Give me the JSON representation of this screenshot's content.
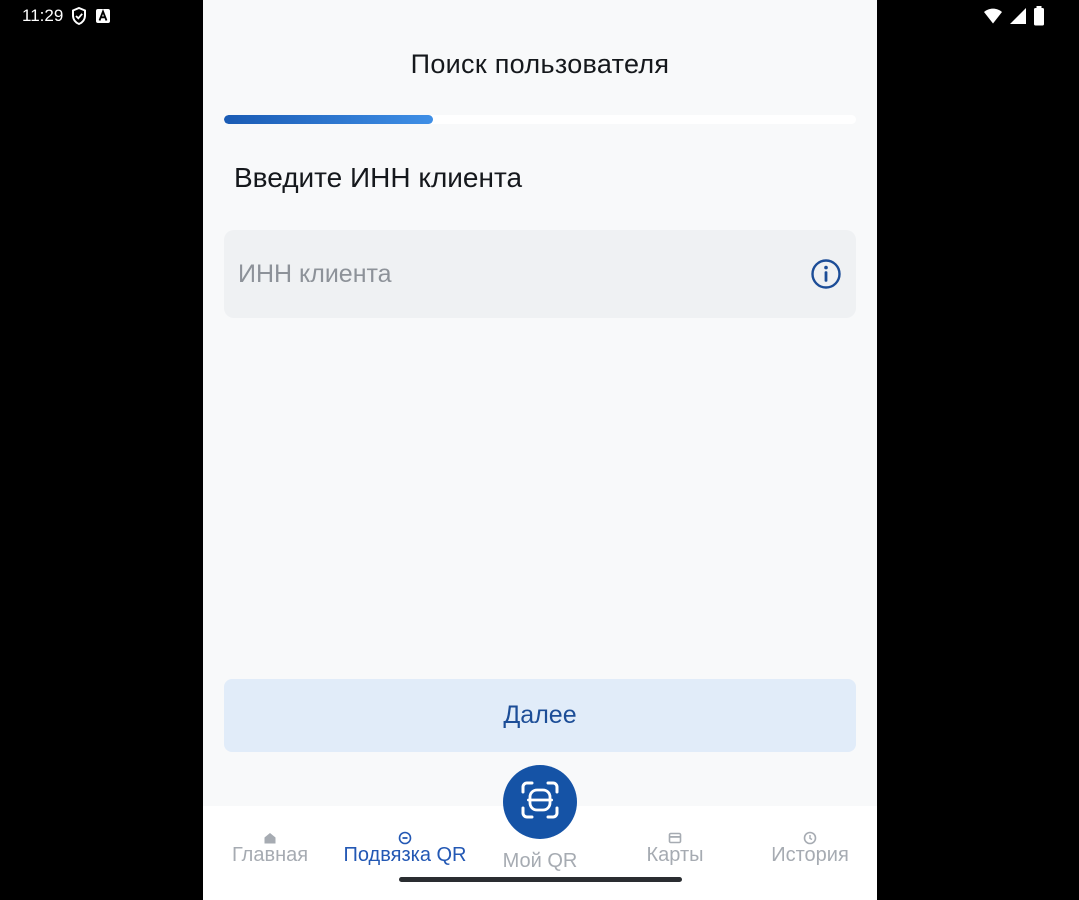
{
  "status_bar": {
    "time": "11:29",
    "icons_left": [
      "shield-icon",
      "a-badge-icon"
    ],
    "icons_right": [
      "wifi-icon",
      "cellular-signal-icon",
      "battery-icon"
    ]
  },
  "screen": {
    "title": "Поиск пользователя",
    "progress": 0.33
  },
  "form": {
    "prompt": "Введите ИНН клиента",
    "inn_field": {
      "value": "",
      "placeholder": "ИНН клиента",
      "icon": "info-icon"
    },
    "next_button_label": "Далее"
  },
  "bottom_nav": {
    "items": [
      {
        "label": "Главная",
        "icon": "home-icon",
        "active": false
      },
      {
        "label": "Подвязка QR",
        "icon": "link-qr-icon",
        "active": true
      },
      {
        "label": "Мой QR",
        "icon": "scan-qr-icon",
        "active": false
      },
      {
        "label": "Карты",
        "icon": "card-icon",
        "active": false
      },
      {
        "label": "История",
        "icon": "clock-icon",
        "active": false
      }
    ]
  },
  "colors": {
    "accent": "#1553a6",
    "active_nav": "#2358b4",
    "inactive_nav": "#a6abb2",
    "button_bg": "#e1ecf9",
    "button_text": "#1c4d97",
    "background": "#f8f9fa",
    "input_bg": "#eff1f3"
  }
}
